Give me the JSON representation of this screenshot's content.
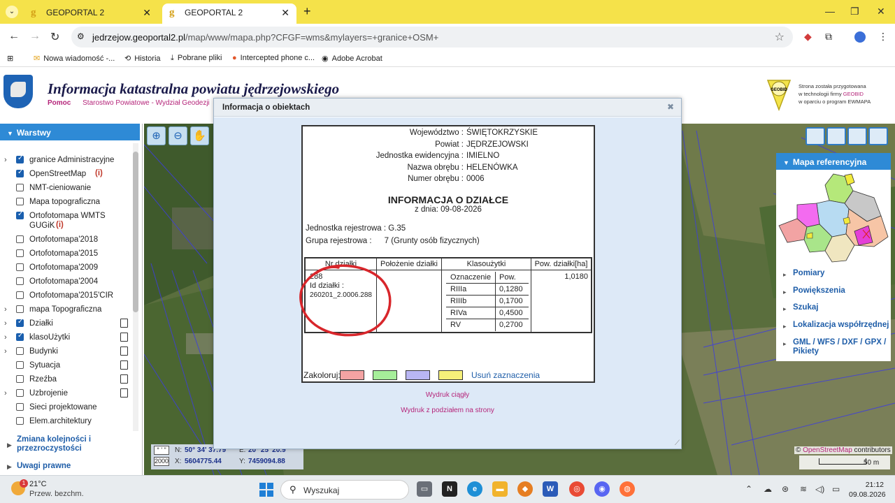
{
  "browser": {
    "tabs": [
      {
        "title": "GEOPORTAL 2",
        "active": false
      },
      {
        "title": "GEOPORTAL 2",
        "active": true
      }
    ],
    "url_host": "jedrzejow.geoportal2.pl",
    "url_path": "/map/www/mapa.php?CFGF=wms&mylayers=+granice+OSM+",
    "bookmarks": [
      "Nowa wiadomość -...",
      "Historia",
      "Pobrane pliki",
      "Intercepted phone c...",
      "Adobe Acrobat"
    ]
  },
  "header": {
    "title": "Informacja katastralna powiatu jędrzejowskiego",
    "help": "Pomoc",
    "office": "Starostwo Powiatowe - Wydział Geodezji",
    "geobid_lines": [
      "Strona została przygotowana",
      "w technologii firmy",
      "GEOBID",
      "w oparciu o program EWMAPA"
    ]
  },
  "layers_panel": {
    "title": "Warstwy",
    "layers": [
      {
        "label": "granice Administracyjne",
        "checked": true,
        "expandable": true,
        "doc": false
      },
      {
        "label": "OpenStreetMap",
        "checked": true,
        "expandable": false,
        "info": "(i)",
        "doc": false
      },
      {
        "label": "NMT-cieniowanie",
        "checked": false,
        "expandable": false,
        "doc": false
      },
      {
        "label": "Mapa topograficzna",
        "checked": false,
        "expandable": false,
        "doc": false
      },
      {
        "label": "Ortofotomapa WMTS GUGiK",
        "checked": true,
        "expandable": false,
        "info": "(i)",
        "doc": false
      },
      {
        "label": "Ortofotomapa'2018",
        "checked": false,
        "expandable": false,
        "doc": false
      },
      {
        "label": "Ortofotomapa'2015",
        "checked": false,
        "expandable": false,
        "doc": false
      },
      {
        "label": "Ortofotomapa'2009",
        "checked": false,
        "expandable": false,
        "doc": false
      },
      {
        "label": "Ortofotomapa'2004",
        "checked": false,
        "expandable": false,
        "doc": false
      },
      {
        "label": "Ortofotomapa'2015'CIR",
        "checked": false,
        "expandable": false,
        "doc": false
      },
      {
        "label": "mapa Topograficzna",
        "checked": false,
        "expandable": true,
        "doc": false
      },
      {
        "label": "Działki",
        "checked": true,
        "expandable": true,
        "doc": true
      },
      {
        "label": "klasoUżytki",
        "checked": true,
        "expandable": true,
        "doc": true
      },
      {
        "label": "Budynki",
        "checked": false,
        "expandable": true,
        "doc": true
      },
      {
        "label": "Sytuacja",
        "checked": false,
        "expandable": false,
        "doc": true
      },
      {
        "label": "Rzeźba",
        "checked": false,
        "expandable": false,
        "doc": true
      },
      {
        "label": "Uzbrojenie",
        "checked": false,
        "expandable": true,
        "doc": true
      },
      {
        "label": "Sieci projektowane",
        "checked": false,
        "expandable": false,
        "doc": false
      },
      {
        "label": "Elem.architektury",
        "checked": false,
        "expandable": false,
        "doc": false
      }
    ],
    "footer": [
      "Zmiana kolejności i przezroczystości",
      "Uwagi prawne"
    ]
  },
  "coords": {
    "unit1": "° ' \"",
    "unit2": "2000",
    "n_label": "N:",
    "n_value": "50° 34' 37.79\"",
    "e_label": "E:",
    "e_value": "20° 25' 20.9\"",
    "x_label": "X:",
    "x_value": "5604775.44",
    "y_label": "Y:",
    "y_value": "7459094.88"
  },
  "ref_panel": {
    "title": "Mapa referencyjna",
    "items": [
      "Pomiary",
      "Powiększenia",
      "Szukaj",
      "Lokalizacja współrzędnej",
      "GML / WFS / DXF / GPX / Pikiety"
    ]
  },
  "attribution": {
    "prefix": "©",
    "osm": "OpenStreetMap",
    "suffix": "contributors"
  },
  "scale": "50 m",
  "modal": {
    "title": "Informacja o obiektach",
    "admin": [
      {
        "k": "Województwo :",
        "v": "ŚWIĘTOKRZYSKIE"
      },
      {
        "k": "Powiat :",
        "v": "JĘDRZEJOWSKI"
      },
      {
        "k": "Jednostka ewidencyjna :",
        "v": "IMIELNO"
      },
      {
        "k": "Nazwa obrębu :",
        "v": "HELENÓWKA"
      },
      {
        "k": "Numer obrębu :",
        "v": "0006"
      }
    ],
    "card_title": "INFORMACJA O DZIAŁCE",
    "card_date": "z dnia: 09-08-2026",
    "reg_unit": "Jednostka rejestrowa : G.35",
    "reg_group_label": "Grupa rejestrowa :",
    "reg_group_value": "7 (Grunty osób fizycznych)",
    "table": {
      "headers": [
        "Nr działki",
        "Położenie działki",
        "Klasoużytki",
        "Pow. działki[ha]"
      ],
      "parcel_no": "288",
      "parcel_id_label": "Id działki :",
      "parcel_id": "260201_2.0006.288",
      "area": "1,0180",
      "class_headers": [
        "Oznaczenie",
        "Pow."
      ],
      "classes": [
        {
          "code": "RIIIa",
          "area": "0,1280"
        },
        {
          "code": "RIIIb",
          "area": "0,1700"
        },
        {
          "code": "RIVa",
          "area": "0,4500"
        },
        {
          "code": "RV",
          "area": "0,2700"
        }
      ]
    },
    "colorize_label": "Zakoloruj:",
    "colors": [
      "#f4a3a3",
      "#a6ee9a",
      "#b9b6f3",
      "#f6f07a"
    ],
    "clear_selection": "Usuń zaznaczenia",
    "print_links": [
      "Wydruk ciągły",
      "Wydruk z podziałem na strony"
    ]
  },
  "taskbar": {
    "weather_badge": "1",
    "temperature": "21°C",
    "weather": "Przew. bezchm.",
    "search_placeholder": "Wyszukaj",
    "time": "21:12",
    "date": "09.08.2026"
  }
}
